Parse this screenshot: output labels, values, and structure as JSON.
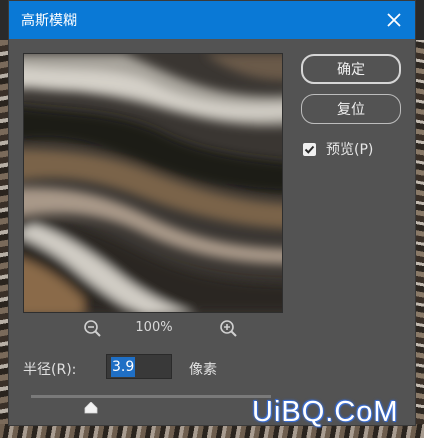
{
  "window": {
    "title": "高斯模糊"
  },
  "buttons": {
    "ok_label": "确定",
    "reset_label": "复位"
  },
  "preview_toggle": {
    "label": "预览(P)",
    "checked": true
  },
  "zoom": {
    "level": "100%"
  },
  "radius": {
    "label": "半径(R):",
    "value": "3.9",
    "unit": "像素",
    "slider_fraction": 0.25
  },
  "watermark": {
    "text": "UiBQ.CoM"
  },
  "icons": {
    "close": "close-icon",
    "zoom_out": "zoom-out-icon",
    "zoom_in": "zoom-in-icon",
    "check": "checkmark-icon",
    "slider": "slider-thumb-icon"
  },
  "colors": {
    "titlebar": "#0a79d6",
    "dialog": "#535353",
    "selection": "#1f6fc5"
  }
}
